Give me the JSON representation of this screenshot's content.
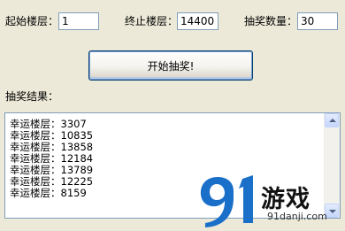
{
  "controls": {
    "start_floor_label": "起始楼层：",
    "start_floor_value": "1",
    "end_floor_label": "终止楼层：",
    "end_floor_value": "14400",
    "draw_count_label": "抽奖数量：",
    "draw_count_value": "30",
    "start_button_label": "开始抽奖!"
  },
  "results": {
    "label": "抽奖结果：",
    "items": [
      "幸运楼层：3307",
      "幸运楼层：10835",
      "幸运楼层：13858",
      "幸运楼层：12184",
      "幸运楼层：13789",
      "幸运楼层：12225",
      "幸运楼层：8159"
    ]
  },
  "watermark": {
    "logo_text": "游戏",
    "logo_mark": "91",
    "url": "91danji.com",
    "color": "#1a6fc9"
  }
}
